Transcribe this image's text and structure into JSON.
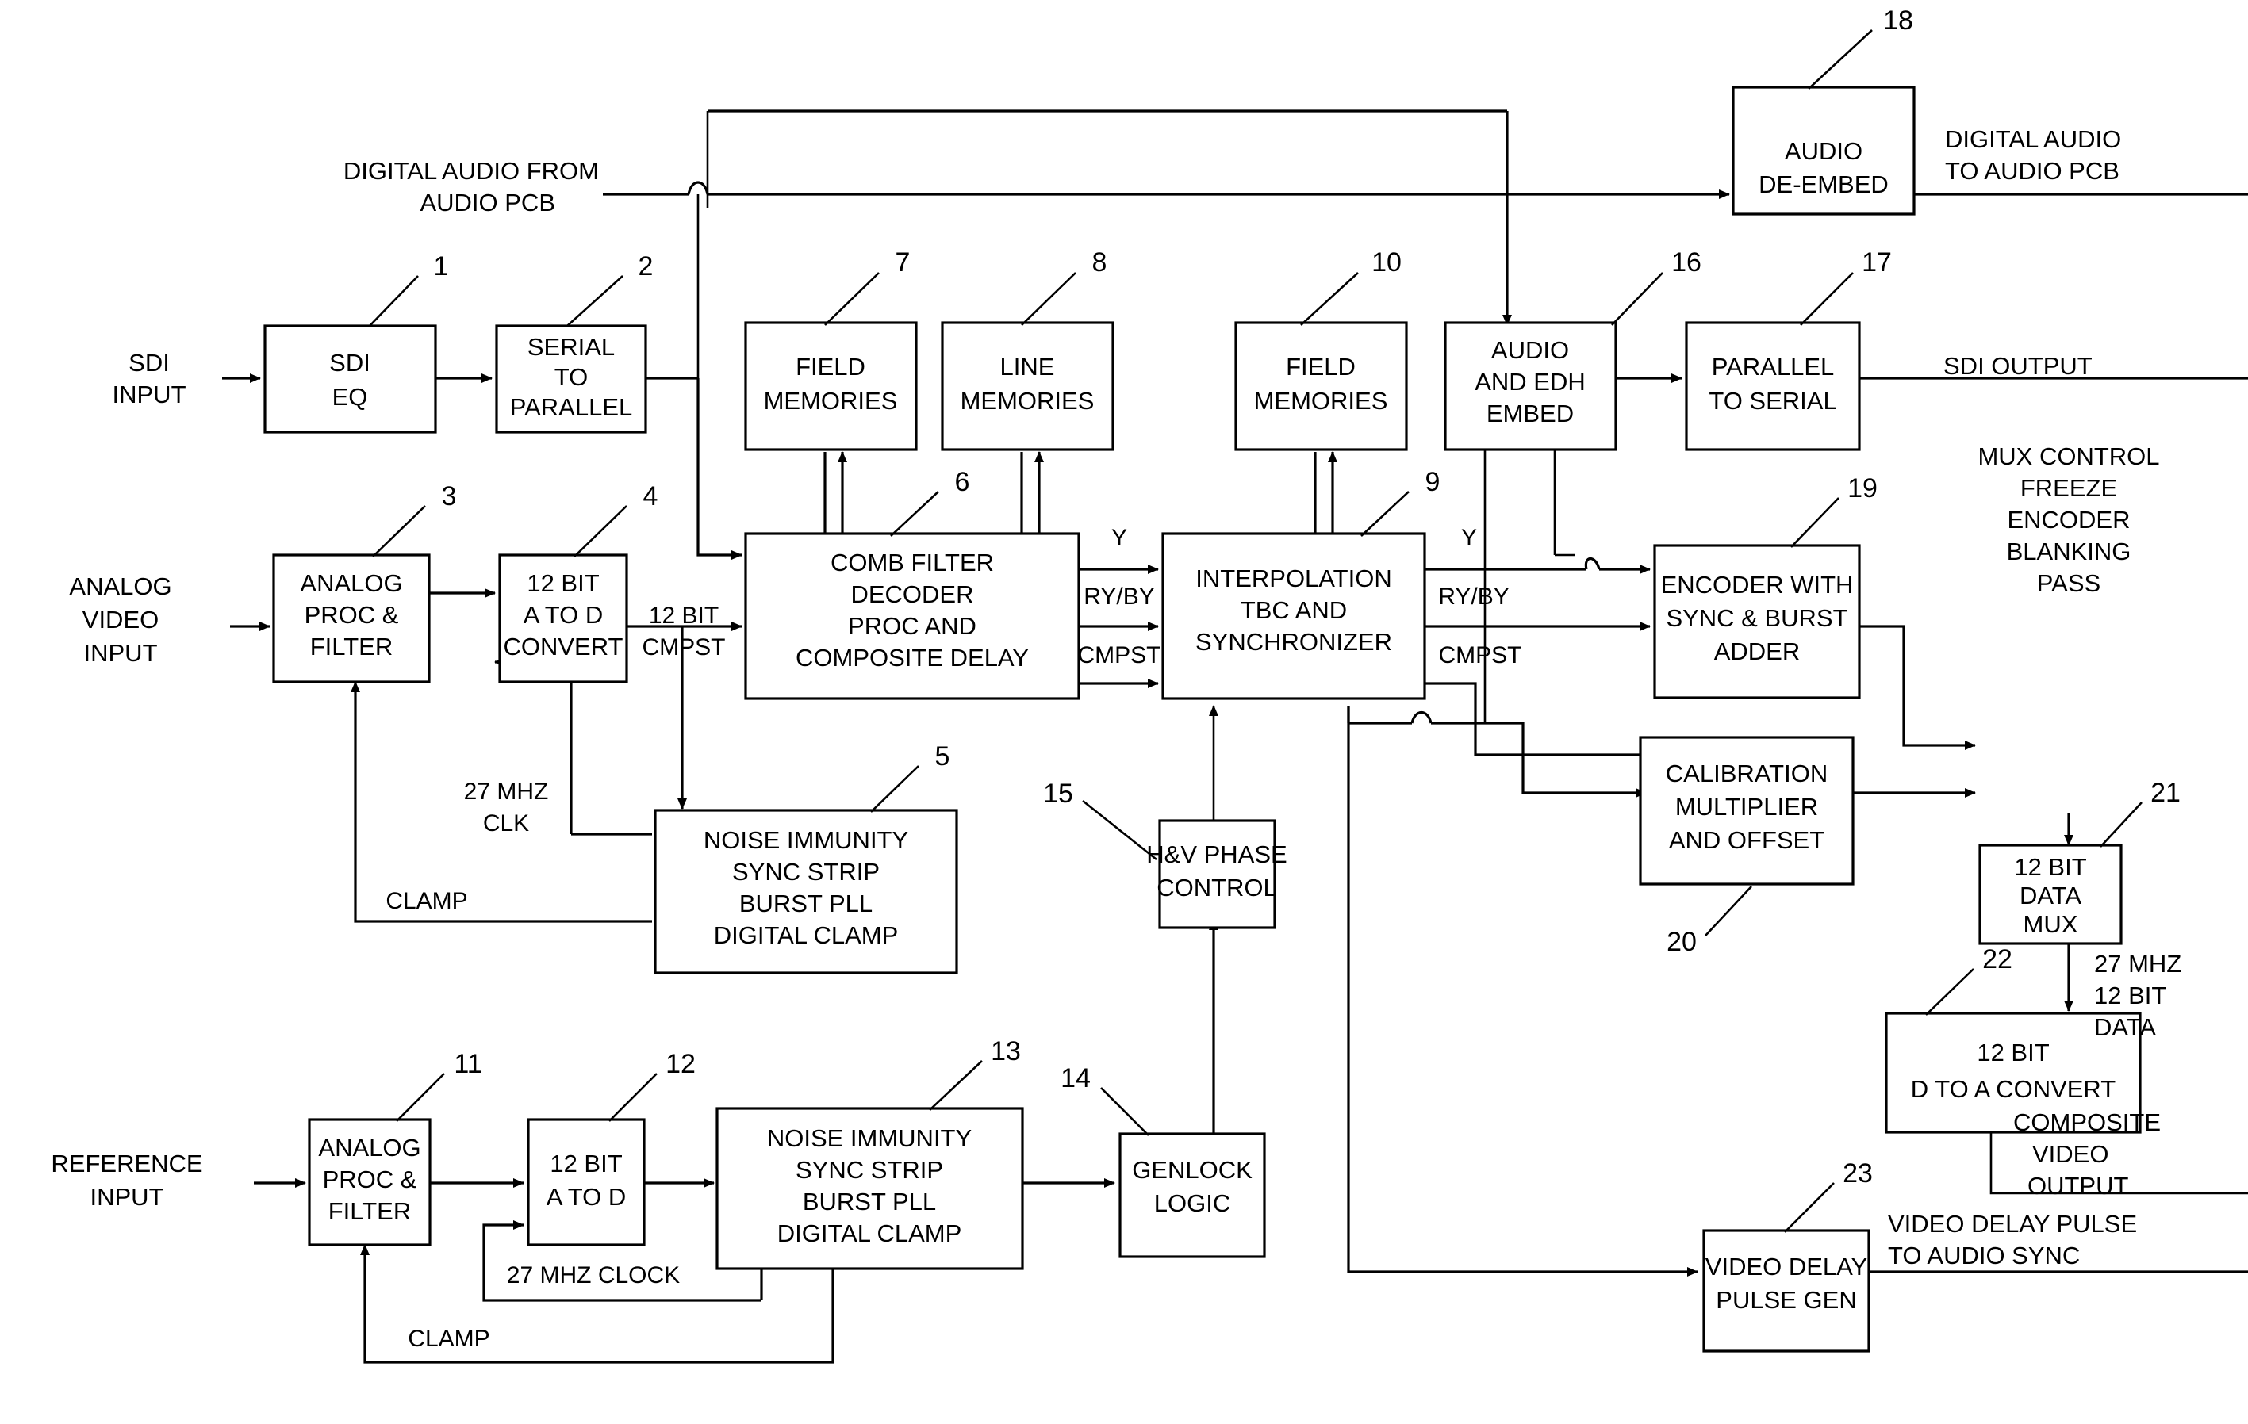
{
  "figure": {
    "type": "patent-block-diagram",
    "title": "Video processing signal path block diagram",
    "background_color": "#ffffff",
    "line_color": "#000000"
  },
  "blocks": [
    {
      "id": "b1",
      "ref": "1",
      "lines": [
        "SDI",
        "EQ"
      ]
    },
    {
      "id": "b2",
      "ref": "2",
      "lines": [
        "SERIAL",
        "TO",
        "PARALLEL"
      ]
    },
    {
      "id": "b7",
      "ref": "7",
      "lines": [
        "FIELD",
        "MEMORIES"
      ]
    },
    {
      "id": "b8",
      "ref": "8",
      "lines": [
        "LINE",
        "MEMORIES"
      ]
    },
    {
      "id": "b10",
      "ref": "10",
      "lines": [
        "FIELD",
        "MEMORIES"
      ]
    },
    {
      "id": "b16",
      "ref": "16",
      "lines": [
        "AUDIO",
        "AND EDH",
        "EMBED"
      ]
    },
    {
      "id": "b17",
      "ref": "17",
      "lines": [
        "PARALLEL",
        "TO SERIAL"
      ]
    },
    {
      "id": "b18",
      "ref": "18",
      "lines": [
        "AUDIO",
        "DE-EMBED"
      ]
    },
    {
      "id": "b3",
      "ref": "3",
      "lines": [
        "ANALOG",
        "PROC &",
        "FILTER"
      ]
    },
    {
      "id": "b4",
      "ref": "4",
      "lines": [
        "12 BIT",
        "A TO D",
        "CONVERT"
      ]
    },
    {
      "id": "b6",
      "ref": "6",
      "lines": [
        "COMB FILTER",
        "DECODER",
        "PROC AND",
        "COMPOSITE DELAY"
      ]
    },
    {
      "id": "b9",
      "ref": "9",
      "lines": [
        "INTERPOLATION",
        "TBC AND",
        "SYNCHRONIZER"
      ]
    },
    {
      "id": "b19",
      "ref": "19",
      "lines": [
        "ENCODER WITH",
        "SYNC & BURST",
        "ADDER"
      ]
    },
    {
      "id": "b21",
      "ref": "21",
      "lines": [
        "12 BIT",
        "DATA",
        "MUX"
      ]
    },
    {
      "id": "b5",
      "ref": "5",
      "lines": [
        "NOISE IMMUNITY",
        "SYNC STRIP",
        "BURST PLL",
        "DIGITAL CLAMP"
      ]
    },
    {
      "id": "b15",
      "ref": "15",
      "lines": [
        "H&V PHASE",
        "CONTROL"
      ]
    },
    {
      "id": "b20",
      "ref": "20",
      "lines": [
        "CALIBRATION",
        "MULTIPLIER",
        "AND OFFSET"
      ]
    },
    {
      "id": "b22",
      "ref": "22",
      "lines": [
        "12 BIT",
        "D TO A CONVERT"
      ]
    },
    {
      "id": "b11",
      "ref": "11",
      "lines": [
        "ANALOG",
        "PROC &",
        "FILTER"
      ]
    },
    {
      "id": "b12",
      "ref": "12",
      "lines": [
        "12 BIT",
        "A TO D"
      ]
    },
    {
      "id": "b13",
      "ref": "13",
      "lines": [
        "NOISE IMMUNITY",
        "SYNC STRIP",
        "BURST PLL",
        "DIGITAL CLAMP"
      ]
    },
    {
      "id": "b14",
      "ref": "14",
      "lines": [
        "GENLOCK",
        "LOGIC"
      ]
    },
    {
      "id": "b23",
      "ref": "23",
      "lines": [
        "VIDEO DELAY",
        "PULSE GEN"
      ]
    }
  ],
  "io_labels": {
    "sdi_input": [
      "SDI",
      "INPUT"
    ],
    "analog_video_input": [
      "ANALOG",
      "VIDEO",
      "INPUT"
    ],
    "reference_input": [
      "REFERENCE",
      "INPUT"
    ],
    "digital_audio_from_audio_pcb": [
      "DIGITAL AUDIO FROM",
      "AUDIO PCB"
    ],
    "digital_audio_to_audio_pcb": [
      "DIGITAL AUDIO",
      "TO AUDIO PCB"
    ],
    "sdi_output": [
      "SDI OUTPUT"
    ],
    "mux_control": [
      "MUX CONTROL",
      "FREEZE",
      "ENCODER",
      "BLANKING",
      "PASS"
    ],
    "composite_video_output": [
      "COMPOSITE",
      "VIDEO",
      "OUTPUT"
    ],
    "video_delay_pulse_to_audio_sync": [
      "VIDEO DELAY PULSE",
      "TO AUDIO SYNC"
    ]
  },
  "signal_labels": {
    "clk_27mhz_upper": [
      "27 MHZ",
      "CLK"
    ],
    "clk_27mhz_lower": [
      "27 MHZ CLOCK"
    ],
    "clamp_upper": "CLAMP",
    "clamp_lower": "CLAMP",
    "cmpst_12bit": [
      "12 BIT",
      "CMPST"
    ],
    "data_27mhz_12bit": [
      "27 MHZ",
      "12 BIT",
      "DATA"
    ],
    "y_decoder_out": "Y",
    "ryby_decoder_out": "RY/BY",
    "cmpst_decoder_out": "CMPST",
    "y_tbc_out": "Y",
    "ryby_tbc_out": "RY/BY",
    "cmpst_tbc_out": "CMPST"
  },
  "reference_numerals": [
    "1",
    "2",
    "3",
    "4",
    "5",
    "6",
    "7",
    "8",
    "9",
    "10",
    "11",
    "12",
    "13",
    "14",
    "15",
    "16",
    "17",
    "18",
    "19",
    "20",
    "21",
    "22",
    "23"
  ]
}
